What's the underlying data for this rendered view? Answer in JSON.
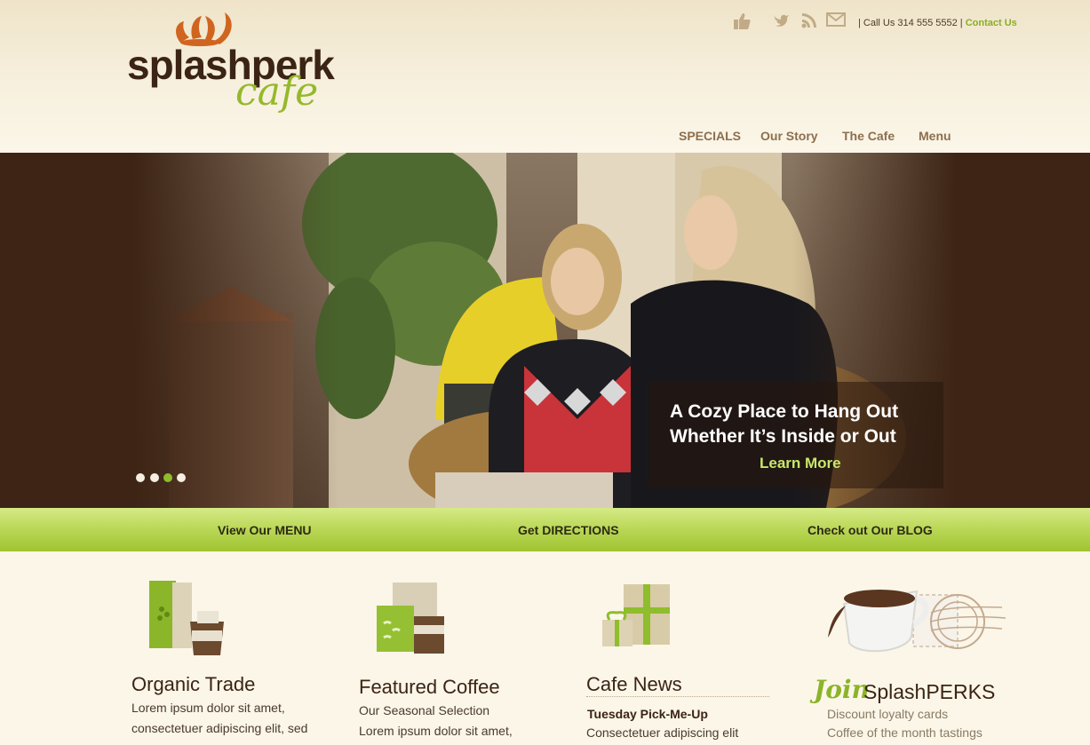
{
  "brand": {
    "name": "splashperk",
    "sub": "cafe"
  },
  "header": {
    "call_text": "| Call Us 314 555 5552 |",
    "contact_label": "Contact Us",
    "icons": [
      "thumbs-up-icon",
      "twitter-bird-icon",
      "rss-icon",
      "mail-icon"
    ]
  },
  "nav": {
    "items": [
      {
        "label": "SPECIALS"
      },
      {
        "label": "Our Story"
      },
      {
        "label": "The Cafe"
      },
      {
        "label": "Menu"
      }
    ]
  },
  "hero": {
    "title_line1": "A Cozy Place to Hang Out",
    "title_line2": "Whether It’s Inside or Out",
    "cta": "Learn More",
    "slides_total": 4,
    "active_slide": 3
  },
  "greenbar": {
    "links": [
      {
        "label": "View Our MENU"
      },
      {
        "label": "Get DIRECTIONS"
      },
      {
        "label": "Check out Our BLOG"
      }
    ]
  },
  "features": {
    "organic": {
      "title": "Organic Trade",
      "line1": "Lorem ipsum dolor sit amet,",
      "line2": "consectetuer adipiscing elit, sed"
    },
    "coffee": {
      "title": "Featured Coffee",
      "line1": "Our Seasonal Selection",
      "line2": "Lorem ipsum dolor sit amet,"
    },
    "news": {
      "title": "Cafe News",
      "subtitle": "Tuesday Pick-Me-Up",
      "line1": "Consectetuer adipiscing elit"
    },
    "join": {
      "join_word": "Join",
      "brand": "SplashPERKS",
      "line1": "Discount loyalty cards",
      "line2": "Coffee of the month tastings"
    }
  },
  "colors": {
    "brand_brown": "#3b2414",
    "brand_green": "#94b92b",
    "nav_text": "#8c6f4e",
    "contact_green": "#8bae21"
  }
}
